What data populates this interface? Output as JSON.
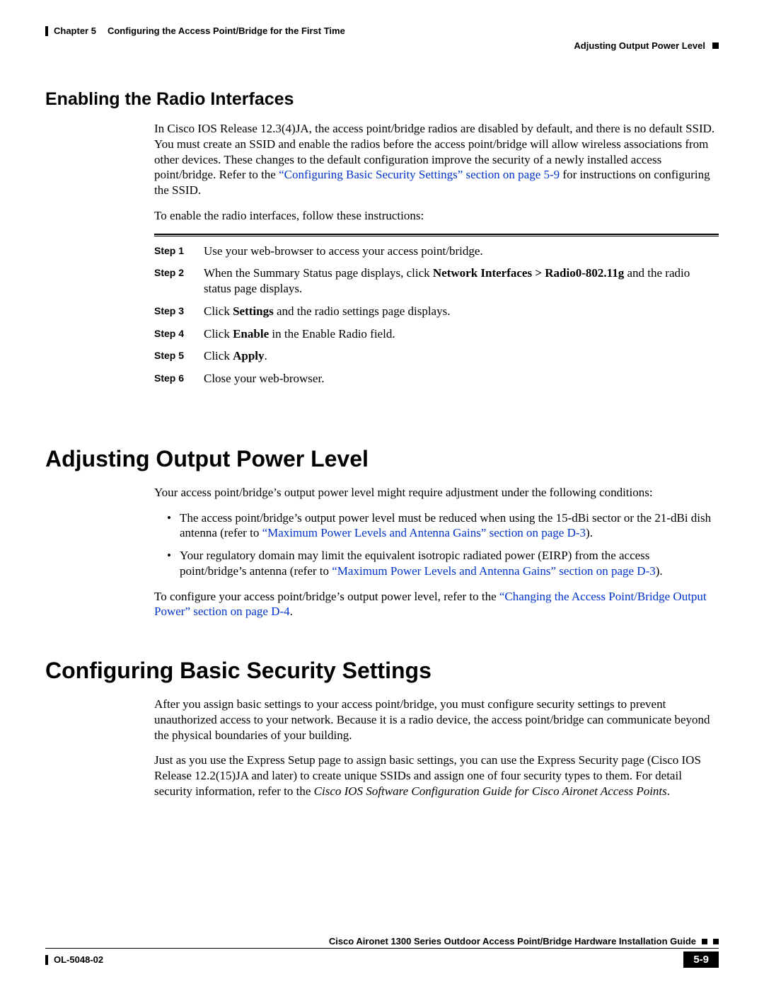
{
  "header": {
    "chapter_label": "Chapter 5",
    "chapter_title": "Configuring the Access Point/Bridge for the First Time",
    "section_right": "Adjusting Output Power Level"
  },
  "s1": {
    "heading": "Enabling the Radio Interfaces",
    "para1_a": "In Cisco IOS Release 12.3(4)JA, the access point/bridge radios are disabled by default, and there is no default SSID. You must create an SSID and enable the radios before the access point/bridge will allow wireless associations from other devices. These changes to the default configuration improve the security of a newly installed access point/bridge. Refer to the ",
    "para1_link": "“Configuring Basic Security Settings” section on page 5-9",
    "para1_b": " for instructions on configuring the SSID.",
    "para2": "To enable the radio interfaces, follow these instructions:",
    "steps": [
      {
        "label": "Step 1",
        "text": "Use your web-browser to access your access point/bridge."
      },
      {
        "label": "Step 2",
        "text_a": "When the Summary Status page displays, click ",
        "bold": "Network Interfaces > Radio0-802.11g",
        "text_b": " and the radio status page displays."
      },
      {
        "label": "Step 3",
        "text_a": "Click ",
        "bold": "Settings",
        "text_b": " and the radio settings page displays."
      },
      {
        "label": "Step 4",
        "text_a": "Click ",
        "bold": "Enable",
        "text_b": " in the Enable Radio field."
      },
      {
        "label": "Step 5",
        "text_a": "Click ",
        "bold": "Apply",
        "text_b": "."
      },
      {
        "label": "Step 6",
        "text": "Close your web-browser."
      }
    ]
  },
  "s2": {
    "heading": "Adjusting Output Power Level",
    "intro": "Your access point/bridge’s output power level might require adjustment under the following conditions:",
    "bullet1_a": "The access point/bridge’s output power level must be reduced when using the 15-dBi sector or the 21-dBi dish antenna (refer to ",
    "bullet1_link": "“Maximum Power Levels and Antenna Gains” section on page D-3",
    "bullet1_b": ").",
    "bullet2_a": "Your regulatory domain may limit the equivalent isotropic radiated power (EIRP) from the access point/bridge’s antenna (refer to ",
    "bullet2_link": "“Maximum Power Levels and Antenna Gains” section on page D-3",
    "bullet2_b": ").",
    "para2_a": "To configure your access point/bridge’s output power level, refer to the ",
    "para2_link": "“Changing the Access Point/Bridge Output Power” section on page D-4",
    "para2_b": "."
  },
  "s3": {
    "heading": "Configuring Basic Security Settings",
    "para1": "After you assign basic settings to your access point/bridge, you must configure security settings to prevent unauthorized access to your network. Because it is a radio device, the access point/bridge can communicate beyond the physical boundaries of your building.",
    "para2_a": "Just as you use the Express Setup page to assign basic settings, you can use the Express Security page (Cisco IOS Release 12.2(15)JA and later) to create unique SSIDs and assign one of four security types to them. For detail security information, refer to the ",
    "para2_italic": "Cisco IOS Software Configuration Guide for Cisco Aironet Access Points",
    "para2_b": "."
  },
  "footer": {
    "guide_title": "Cisco Aironet 1300 Series Outdoor Access Point/Bridge Hardware Installation Guide",
    "doc_id": "OL-5048-02",
    "page_num": "5-9"
  }
}
